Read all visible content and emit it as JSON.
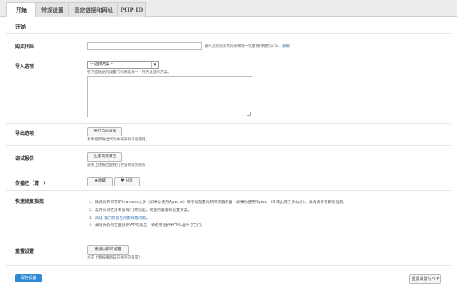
{
  "tabs": [
    {
      "label": "开始"
    },
    {
      "label": "常规设置"
    },
    {
      "label": "固定链接和网址"
    },
    {
      "label": "PHP ID"
    }
  ],
  "section_title": "开始",
  "purchase_code": {
    "label": "购买代码",
    "value": "",
    "hint": "输入您的购买代码来确保一切都保持顺利工作。",
    "link": "获取"
  },
  "import": {
    "label": "导入选项",
    "select_value": "-- 选择方案 --",
    "hint": "在下面粘贴的设置代码来选择一个持先设定的方案。",
    "textarea_value": ""
  },
  "export": {
    "label": "导出选项",
    "button": "导出当前设置",
    "hint": "复制后即导出代码并保存供日后使用。"
  },
  "debug": {
    "label": "调试报告",
    "button": "生成调试报告",
    "hint": "遇到上述报告使我们更容易得到服务"
  },
  "share": {
    "label": "传播它（请！）",
    "buttons": [
      "★收藏",
      "♥ 分享"
    ]
  },
  "quick_fix": {
    "label": "快速修复指南",
    "items": [
      {
        "n": "1.",
        "text": "确保你有可写的htaccess文件（如果你使用Apache）或手动配置你的网页服务器（如果你使用Nginx、IIS 或此网了多站点），详情请参考安装指南。"
      },
      {
        "n": "2.",
        "text": "禁用你们在没有星号(*)的功能。或使用兼容的设置方案。"
      },
      {
        "n": "3.",
        "text": "阅读 我们的常见问题解答问题。"
      },
      {
        "n": "4.",
        "text": "如果你仍然在面接到WP的反应，请使用 替代HTML插件打它们。"
      }
    ]
  },
  "reset_block": {
    "label": "重置设置",
    "button": "重设以前的设置",
    "hint": "点击上面按重新日前保存的设置！"
  },
  "footer": {
    "save": "保存设置",
    "reset": "重置设置为PHP"
  }
}
